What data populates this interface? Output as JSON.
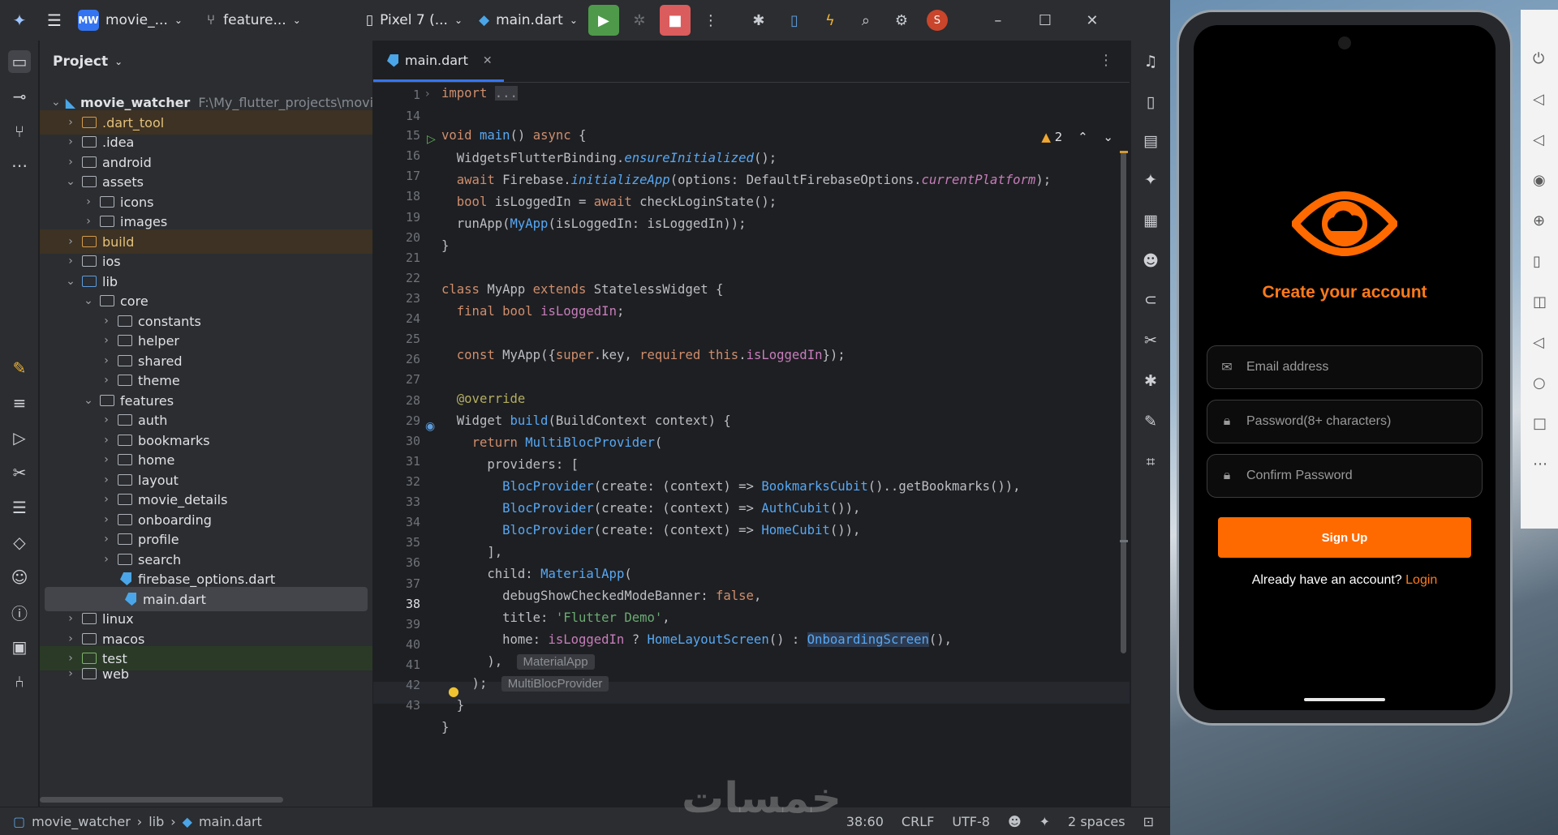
{
  "titlebar": {
    "project": "movie_...",
    "project_badge": "MW",
    "branch": "feature...",
    "device": "Pixel 7 (...",
    "run_config": "main.dart",
    "avatar": "S"
  },
  "project_panel": {
    "title": "Project",
    "root_name": "movie_watcher",
    "root_path": "F:\\My_flutter_projects\\movi",
    "items": [
      {
        "name": ".dart_tool"
      },
      {
        "name": ".idea"
      },
      {
        "name": "android"
      },
      {
        "name": "assets"
      },
      {
        "name": "icons"
      },
      {
        "name": "images"
      },
      {
        "name": "build"
      },
      {
        "name": "ios"
      },
      {
        "name": "lib"
      },
      {
        "name": "core"
      },
      {
        "name": "constants"
      },
      {
        "name": "helper"
      },
      {
        "name": "shared"
      },
      {
        "name": "theme"
      },
      {
        "name": "features"
      },
      {
        "name": "auth"
      },
      {
        "name": "bookmarks"
      },
      {
        "name": "home"
      },
      {
        "name": "layout"
      },
      {
        "name": "movie_details"
      },
      {
        "name": "onboarding"
      },
      {
        "name": "profile"
      },
      {
        "name": "search"
      },
      {
        "name": "firebase_options.dart"
      },
      {
        "name": "main.dart"
      },
      {
        "name": "linux"
      },
      {
        "name": "macos"
      },
      {
        "name": "test"
      },
      {
        "name": "web"
      }
    ]
  },
  "editor": {
    "tab": "main.dart",
    "warnings": "2",
    "line_numbers": [
      "1",
      "14",
      "15",
      "16",
      "17",
      "18",
      "19",
      "20",
      "21",
      "22",
      "23",
      "24",
      "25",
      "26",
      "27",
      "28",
      "29",
      "30",
      "31",
      "32",
      "33",
      "34",
      "35",
      "36",
      "37",
      "38",
      "39",
      "40",
      "41",
      "42",
      "43"
    ],
    "inlay_hints": {
      "l39": "MaterialApp",
      "l40": "MultiBlocProvider"
    }
  },
  "statusbar": {
    "crumb_project": "movie_watcher",
    "crumb_dir": "lib",
    "crumb_file": "main.dart",
    "position": "38:60",
    "line_sep": "CRLF",
    "encoding": "UTF-8",
    "indent": "2 spaces"
  },
  "phone": {
    "title": "Create your account",
    "email_placeholder": "Email address",
    "password_placeholder": "Password(8+ characters)",
    "confirm_placeholder": "Confirm Password",
    "signup_label": "Sign Up",
    "already_text": "Already have an account?",
    "login_link": "Login",
    "accent": "#ff6a00"
  },
  "watermark": "خمسات"
}
